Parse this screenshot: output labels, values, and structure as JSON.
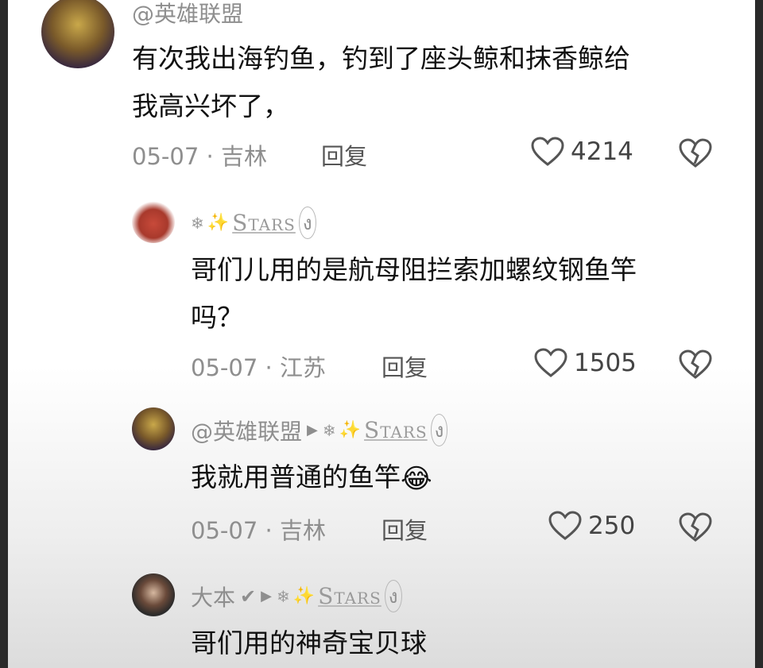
{
  "comments": [
    {
      "username": "@英雄联盟",
      "text_line1": "有次我出海钓鱼，钓到了座头鲸和抹香鲸给",
      "text_line2": "我高兴坏了，",
      "date": "05-07",
      "location": "吉林",
      "reply_label": "回复",
      "likes": "4214"
    },
    {
      "tag_name": "Stars",
      "text_line1": "哥们儿用的是航母阻拦索加螺纹钢鱼竿",
      "text_line2": "吗？",
      "date": "05-07",
      "location": "江苏",
      "reply_label": "回复",
      "likes": "1505"
    },
    {
      "username": "@英雄联盟",
      "reply_to": "Stars",
      "text": "我就用普通的鱼竿",
      "emoji": "😂",
      "date": "05-07",
      "location": "吉林",
      "reply_label": "回复",
      "likes": "250"
    },
    {
      "username": "大本",
      "reply_to": "Stars",
      "text": "哥们用的神奇宝贝球"
    }
  ],
  "separator": "·",
  "colors": {
    "meta": "#8e8e8e",
    "text": "#111111",
    "sparkle": "#e8c85a"
  }
}
